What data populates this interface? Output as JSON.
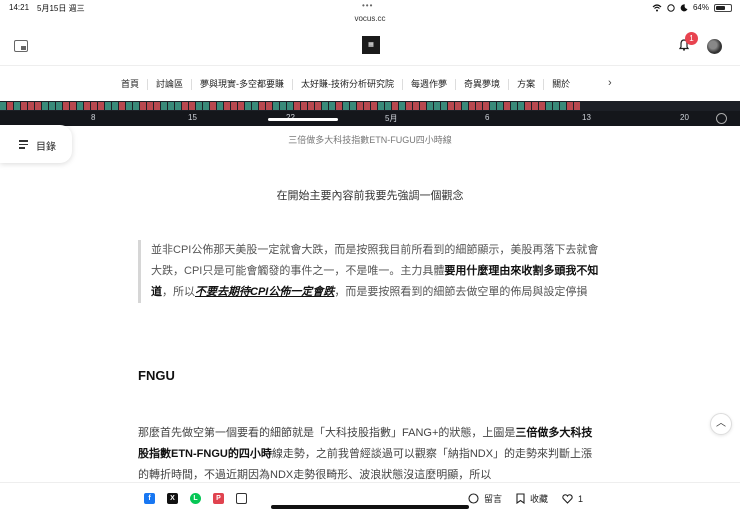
{
  "status_bar": {
    "time": "14:21",
    "date": "5月15日 週三",
    "battery": "64%",
    "battery_level": 0.64,
    "dots": "•••"
  },
  "browser": {
    "url": "vocus.cc"
  },
  "header": {
    "notification_count": "1"
  },
  "nav": {
    "items": [
      "首頁",
      "討論區",
      "夢與現實-多空都要賺",
      "太好賺-技術分析研究院",
      "每週作夢",
      "奇異夢境",
      "方案",
      "關於"
    ],
    "next": "›"
  },
  "chart_axis": {
    "ticks": [
      "8",
      "15",
      "22",
      "29",
      "5月",
      "6",
      "13",
      "20"
    ]
  },
  "image_caption": "三倍做多大科技指數ETN-FUGU四小時線",
  "toc": {
    "label": "目錄"
  },
  "article": {
    "lead": "在開始主要內容前我要先強調一個觀念",
    "quote": {
      "part1": "並非CPI公佈那天美股一定就會大跌，而是按照我目前所看到的細節顯示，美股再落下去就會大跌，CPI只是可能會觸發的事件之一，不是唯一。主力具體",
      "bold1": "要用什麼理由來收割多頭我不知道",
      "part2": "，所以",
      "underlined": "不要去期待CPI公佈一定會跌",
      "part3": "，而是要按照看到的細節去做空單的佈局與設定停損"
    },
    "section_heading": "FNGU",
    "para": {
      "part1": "那麼首先做空第一個要看的細節就是「大科技股指數」FANG+的狀態，上圖是",
      "bold1": "三倍做多大科技股指數ETN-FNGU的四小時",
      "part2": "線走勢，之前我曾經談過可以觀察「納指NDX」的走勢來判斷上漲的轉折時間，不過近期因為NDX走勢很畸形、波浪狀態沒這麼明顯，所以"
    }
  },
  "toolbar": {
    "share_icons": [
      "facebook-icon",
      "x-icon",
      "line-icon",
      "plurk-icon",
      "copy-link-icon"
    ],
    "comment_label": "留言",
    "bookmark_label": "收藏",
    "like_count": "1"
  },
  "colors": {
    "up": "#3a8a7a",
    "down": "#b8484f",
    "badge": "#e8434f"
  }
}
